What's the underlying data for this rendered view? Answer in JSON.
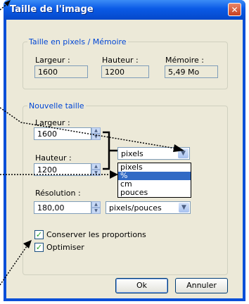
{
  "window": {
    "title": "Taille de l'image",
    "close_glyph": "✕"
  },
  "pixel_group": {
    "legend": "Taille en pixels / Mémoire",
    "width_label": "Largeur :",
    "width_value": "1600",
    "height_label": "Hauteur :",
    "height_value": "1200",
    "memory_label": "Mémoire :",
    "memory_value": "5,49 Mo"
  },
  "new_size_group": {
    "legend": "Nouvelle taille",
    "width_label": "Largeur :",
    "width_value": "1600",
    "height_label": "Hauteur :",
    "height_value": "1200",
    "unit_selected": "pixels",
    "unit_options": [
      "pixels",
      "%",
      "cm",
      "pouces"
    ],
    "unit_highlighted": "%",
    "resolution_label": "Résolution :",
    "resolution_value": "180,00",
    "resolution_unit": "pixels/pouces"
  },
  "options": {
    "keep_proportions": {
      "label": "Conserver les proportions",
      "checked": true
    },
    "optimize": {
      "label": "Optimiser",
      "checked": true
    }
  },
  "buttons": {
    "ok": "Ok",
    "cancel": "Annuler"
  },
  "colors": {
    "title_bar": "#0a5ae6",
    "legend_text": "#0046d5",
    "selection": "#316ac5"
  }
}
